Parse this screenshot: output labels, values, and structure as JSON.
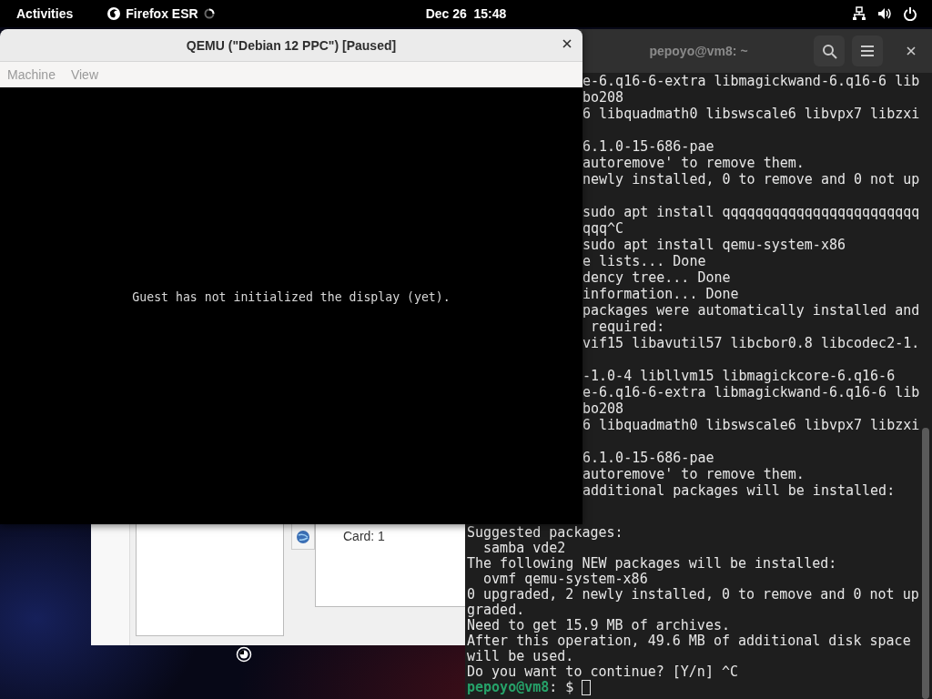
{
  "top_bar": {
    "activities": "Activities",
    "app_name": "Firefox ESR",
    "clock": "Dec 26  15:48"
  },
  "qemu_window": {
    "title": "QEMU (\"Debian 12 PPC\") [Paused]",
    "menu": [
      {
        "label": "Machine",
        "disabled": true
      },
      {
        "label": "View",
        "disabled": true
      }
    ],
    "display_message": "Guest has not initialized the display (yet)."
  },
  "background_window": {
    "card_label": "Card: 1"
  },
  "terminal_window": {
    "title": "pepoyo@vm8: ~",
    "partial_lines": [
      {
        "kind": "text",
        "text": "e-6.q16-6-extra libmagickwand-6.q16-6 lib"
      },
      {
        "kind": "text",
        "text": "bo208"
      },
      {
        "kind": "text",
        "text": "6 libquadmath0 libswscale6 libvpx7 libzxi"
      },
      {
        "kind": "blank"
      },
      {
        "kind": "text",
        "text": "6.1.0-15-686-pae"
      },
      {
        "kind": "text",
        "text": "autoremove' to remove them."
      },
      {
        "kind": "text",
        "text": "newly installed, 0 to remove and 0 not up"
      },
      {
        "kind": "blank"
      },
      {
        "kind": "text",
        "text": "sudo apt install qqqqqqqqqqqqqqqqqqqqqqqq"
      },
      {
        "kind": "text",
        "text": "qqq^C"
      },
      {
        "kind": "text",
        "text": "sudo apt install qemu-system-x86"
      },
      {
        "kind": "text",
        "text": "e lists... Done"
      },
      {
        "kind": "text",
        "text": "dency tree... Done"
      },
      {
        "kind": "text",
        "text": "information... Done"
      },
      {
        "kind": "text",
        "text": "packages were automatically installed and"
      },
      {
        "kind": "text",
        "text": " required:"
      },
      {
        "kind": "text",
        "text": "vif15 libavutil57 libcbor0.8 libcodec2-1."
      },
      {
        "kind": "blank"
      },
      {
        "kind": "text",
        "text": "-1.0-4 libllvm15 libmagickcore-6.q16-6"
      },
      {
        "kind": "text",
        "text": "e-6.q16-6-extra libmagickwand-6.q16-6 lib"
      },
      {
        "kind": "text",
        "text": "bo208"
      },
      {
        "kind": "text",
        "text": "6 libquadmath0 libswscale6 libvpx7 libzxi"
      },
      {
        "kind": "blank"
      },
      {
        "kind": "text",
        "text": "6.1.0-15-686-pae"
      },
      {
        "kind": "text",
        "text": "autoremove' to remove them."
      },
      {
        "kind": "text",
        "text": "additional packages will be installed:"
      },
      {
        "kind": "blank"
      }
    ],
    "lines": [
      {
        "kind": "text",
        "text": "Suggested packages:"
      },
      {
        "kind": "text",
        "text": "  samba vde2"
      },
      {
        "kind": "text",
        "text": "The following NEW packages will be installed:"
      },
      {
        "kind": "text",
        "text": "  ovmf qemu-system-x86"
      },
      {
        "kind": "text",
        "text": "0 upgraded, 2 newly installed, 0 to remove and 0 not up"
      },
      {
        "kind": "text",
        "text": "graded."
      },
      {
        "kind": "text",
        "text": "Need to get 15.9 MB of archives."
      },
      {
        "kind": "text",
        "text": "After this operation, 49.6 MB of additional disk space"
      },
      {
        "kind": "text",
        "text": "will be used."
      },
      {
        "kind": "text",
        "text": "Do you want to continue? [Y/n] ^C"
      }
    ],
    "prompt": {
      "user_host": "pepoyo@vm8",
      "rest": ": $ "
    }
  }
}
